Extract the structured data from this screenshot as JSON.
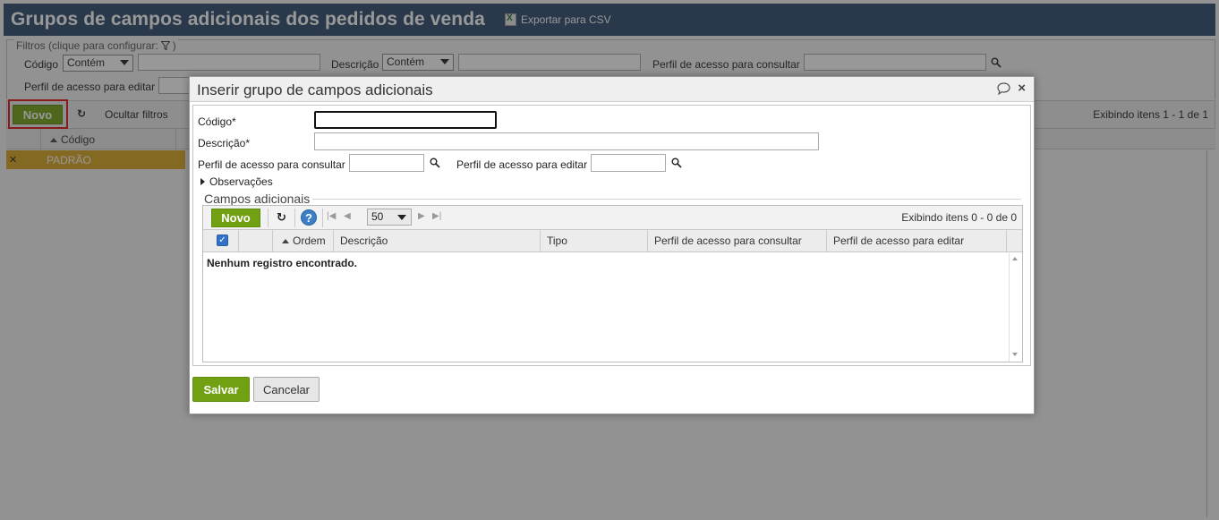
{
  "background": {
    "title": "Grupos de campos adicionais dos pedidos de venda",
    "export_label": "Exportar para CSV",
    "filters": {
      "legend": "Filtros (clique para configurar:",
      "legend_close": ")",
      "codigo_label": "Código",
      "codigo_mode": "Contém",
      "descricao_label": "Descrição",
      "descricao_mode": "Contém",
      "perfil_consultar_label": "Perfil de acesso para consultar",
      "perfil_editar_label": "Perfil de acesso para editar"
    },
    "toolbar": {
      "novo_label": "Novo",
      "refresh_icon": "↻",
      "ocultar_label": "Ocultar filtros",
      "exibindo": "Exibindo itens 1 - 1 de 1"
    },
    "grid": {
      "codigo_header": "Código",
      "rows": [
        {
          "codigo": "PADRÃO"
        }
      ]
    }
  },
  "dialog": {
    "title": "Inserir grupo de campos adicionais",
    "close_icon": "×",
    "form": {
      "codigo_label": "Código*",
      "codigo_value": "",
      "descricao_label": "Descrição*",
      "descricao_value": "",
      "perfil_consultar_label": "Perfil de acesso para consultar",
      "perfil_editar_label": "Perfil de acesso para editar",
      "observacoes_label": "Observações"
    },
    "campos": {
      "section_title": "Campos adicionais",
      "novo_label": "Novo",
      "refresh_icon": "↻",
      "help_icon": "?",
      "page_size": "50",
      "exibindo": "Exibindo itens 0 - 0 de 0",
      "columns": [
        "Ordem",
        "Descrição",
        "Tipo",
        "Perfil de acesso para consultar",
        "Perfil de acesso para editar"
      ],
      "empty_message": "Nenhum registro encontrado."
    },
    "salvar_label": "Salvar",
    "cancelar_label": "Cancelar"
  },
  "colors": {
    "header_bg": "#2b4a6b",
    "accent_green": "#71a113",
    "highlight_row": "#d9a520",
    "highlight_box": "#e01212"
  }
}
